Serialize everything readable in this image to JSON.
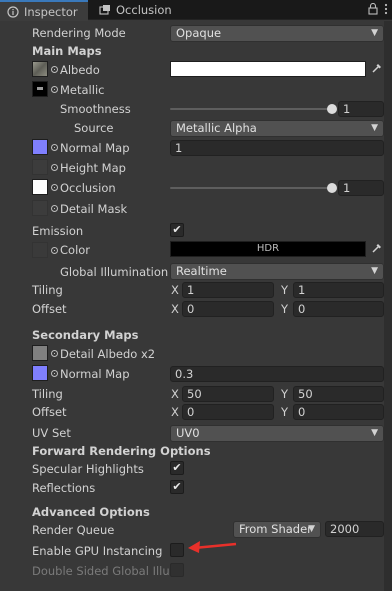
{
  "tabs": [
    {
      "label": "Inspector",
      "icon": "info-icon"
    },
    {
      "label": "Occlusion",
      "icon": "occlusion-icon"
    }
  ],
  "rendering_mode": {
    "label": "Rendering Mode",
    "value": "Opaque"
  },
  "main_maps": {
    "header": "Main Maps",
    "albedo": {
      "label": "Albedo",
      "color": "#ffffff"
    },
    "metallic": {
      "label": "Metallic"
    },
    "smoothness": {
      "label": "Smoothness",
      "value": "1",
      "fraction": 1.0
    },
    "source": {
      "label": "Source",
      "value": "Metallic Alpha"
    },
    "normal_map": {
      "label": "Normal Map",
      "value": "1"
    },
    "height_map": {
      "label": "Height Map"
    },
    "occlusion": {
      "label": "Occlusion",
      "value": "1",
      "fraction": 1.0
    },
    "detail_mask": {
      "label": "Detail Mask"
    },
    "emission": {
      "label": "Emission",
      "checked": true
    },
    "emission_color": {
      "label": "Color",
      "hdr": "HDR",
      "color": "#000000"
    },
    "global_illumination": {
      "label": "Global Illumination",
      "value": "Realtime"
    },
    "tiling": {
      "label": "Tiling",
      "x_label": "X",
      "x": "1",
      "y_label": "Y",
      "y": "1"
    },
    "offset": {
      "label": "Offset",
      "x_label": "X",
      "x": "0",
      "y_label": "Y",
      "y": "0"
    }
  },
  "secondary_maps": {
    "header": "Secondary Maps",
    "detail_albedo": {
      "label": "Detail Albedo x2"
    },
    "normal_map": {
      "label": "Normal Map",
      "value": "0.3"
    },
    "tiling": {
      "label": "Tiling",
      "x_label": "X",
      "x": "50",
      "y_label": "Y",
      "y": "50"
    },
    "offset": {
      "label": "Offset",
      "x_label": "X",
      "x": "0",
      "y_label": "Y",
      "y": "0"
    },
    "uv_set": {
      "label": "UV Set",
      "value": "UV0"
    }
  },
  "forward_rendering": {
    "header": "Forward Rendering Options",
    "specular": {
      "label": "Specular Highlights",
      "checked": true
    },
    "reflections": {
      "label": "Reflections",
      "checked": true
    }
  },
  "advanced": {
    "header": "Advanced Options",
    "render_queue": {
      "label": "Render Queue",
      "mode": "From Shader",
      "value": "2000"
    },
    "gpu_instancing": {
      "label": "Enable GPU Instancing",
      "checked": false
    },
    "double_sided_gi": {
      "label": "Double Sided Global Illum",
      "checked": false
    }
  },
  "colors": {
    "normal_map_thumb": "#7f7fff",
    "albedo_thumb": "#7a7a70",
    "detail_albedo_thumb": "#808080",
    "annotation_arrow": "#e8302a"
  }
}
